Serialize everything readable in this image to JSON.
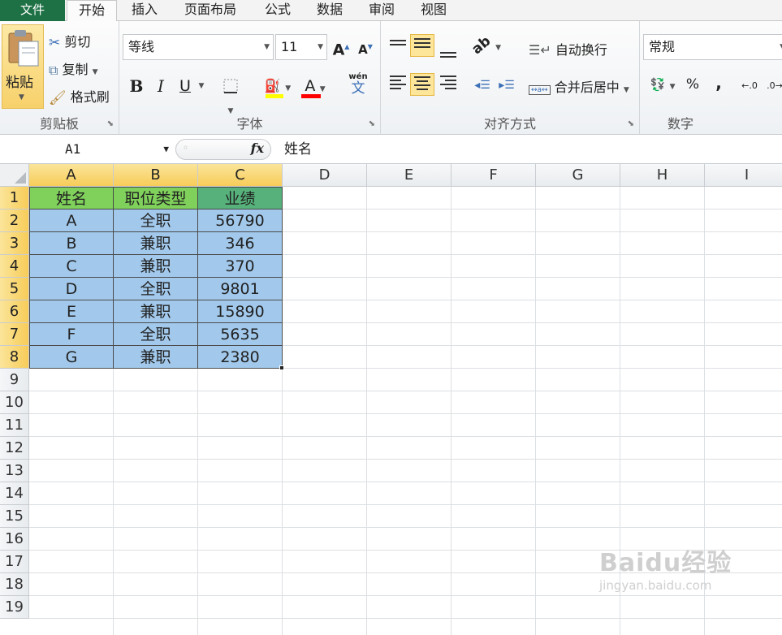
{
  "menu": {
    "tabs": [
      "文件",
      "开始",
      "插入",
      "页面布局",
      "公式",
      "数据",
      "审阅",
      "视图"
    ]
  },
  "ribbon": {
    "clipboard": {
      "label": "剪贴板",
      "paste": "粘贴",
      "cut": "剪切",
      "copy": "复制",
      "format_painter": "格式刷"
    },
    "font": {
      "label": "字体",
      "font_name": "等线",
      "font_size": "11",
      "bold": "B",
      "italic": "I",
      "underline": "U",
      "grow": "A",
      "shrink": "A",
      "font_color_letter": "A",
      "phonetic_top": "wén",
      "phonetic_bottom": "文"
    },
    "alignment": {
      "label": "对齐方式",
      "wrap_text": "自动换行",
      "merge_center": "合并后居中"
    },
    "number": {
      "label": "数字",
      "format": "常规",
      "percent": "%",
      "comma": ","
    },
    "colors": {
      "accent_green": "#1e7145",
      "selected": "#fde59a",
      "fill_yellow": "#ffff00",
      "font_red": "#ff0000"
    }
  },
  "formula_bar": {
    "name_box": "A1",
    "fx": "fx",
    "content": "姓名"
  },
  "sheet": {
    "columns": [
      "A",
      "B",
      "C",
      "D",
      "E",
      "F",
      "G",
      "H",
      "I"
    ],
    "rows": [
      "1",
      "2",
      "3",
      "4",
      "5",
      "6",
      "7",
      "8",
      "9",
      "10",
      "11",
      "12",
      "13",
      "14",
      "15",
      "16",
      "17",
      "18",
      "19"
    ],
    "header": [
      "姓名",
      "职位类型",
      "业绩"
    ],
    "data": [
      [
        "A",
        "全职",
        "56790"
      ],
      [
        "B",
        "兼职",
        "346"
      ],
      [
        "C",
        "兼职",
        "370"
      ],
      [
        "D",
        "全职",
        "9801"
      ],
      [
        "E",
        "兼职",
        "15890"
      ],
      [
        "F",
        "全职",
        "5635"
      ],
      [
        "G",
        "兼职",
        "2380"
      ]
    ],
    "colors": {
      "header_green": "#7fd15b",
      "header_dark_green": "#56b27a",
      "data_blue": "#a2c9ec"
    }
  },
  "watermark": {
    "logo": "Baidu经验",
    "url": "jingyan.baidu.com"
  }
}
